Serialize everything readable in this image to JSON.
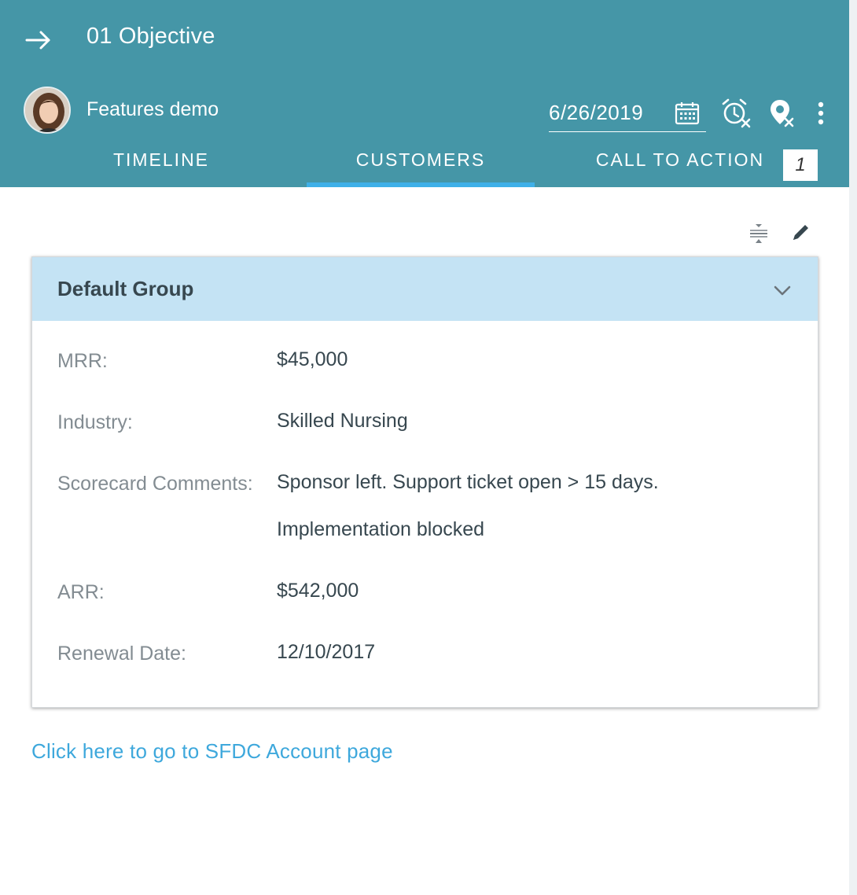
{
  "header": {
    "title": "01 Objective",
    "account_name": "Features demo",
    "date": "6/26/2019",
    "icons": [
      "arrow-right-icon",
      "calendar-icon",
      "snooze-icon",
      "location-icon",
      "more-vertical-icon"
    ],
    "background_color": "#4596a7"
  },
  "tabs": [
    {
      "label": "TIMELINE",
      "active": false
    },
    {
      "label": "CUSTOMERS",
      "active": true
    },
    {
      "label": "CALL TO ACTION",
      "active": false,
      "badge": "1"
    }
  ],
  "toolbar": {
    "icons": [
      "collapse-icon",
      "edit-pencil-icon"
    ]
  },
  "card": {
    "title": "Default Group",
    "header_color": "#c4e3f4",
    "fields": [
      {
        "label": "MRR:",
        "value": "$45,000"
      },
      {
        "label": "Industry:",
        "value": "Skilled Nursing"
      },
      {
        "label": "Scorecard Comments:",
        "value": "Sponsor left. Support ticket open > 15 days.",
        "value_line2": "Implementation blocked"
      },
      {
        "label": "ARR:",
        "value": "$542,000"
      },
      {
        "label": "Renewal Date:",
        "value": "12/10/2017"
      }
    ]
  },
  "link": {
    "text": "Click here to go to SFDC Account page",
    "color": "#3ea8dc"
  }
}
